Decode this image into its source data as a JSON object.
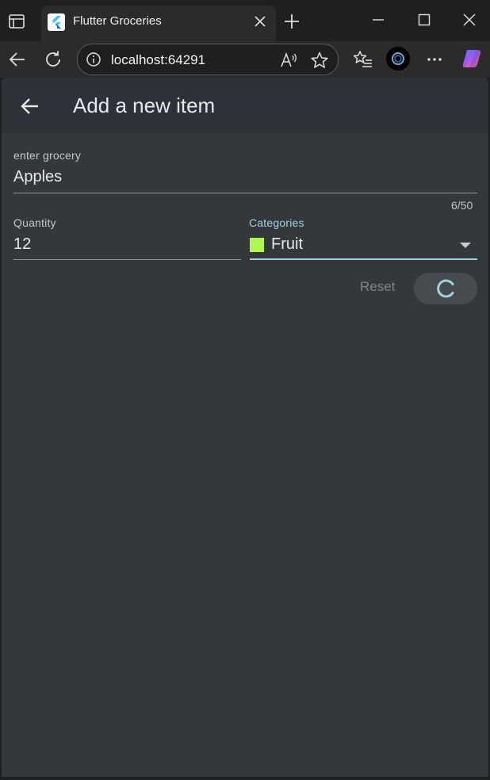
{
  "browser": {
    "tab_title": "Flutter Groceries",
    "url": "localhost:64291"
  },
  "icons": {
    "tab_actions": "tab-actions-icon",
    "favicon": "flutter-logo-icon",
    "tab_close": "close-icon",
    "new_tab": "plus-icon",
    "minimize": "minimize-icon",
    "maximize": "maximize-icon",
    "close_window": "close-icon",
    "back": "arrow-left-icon",
    "reload": "reload-icon",
    "site_info": "info-icon",
    "read_aloud": "read-aloud-icon",
    "favorite": "star-icon",
    "favorites_list": "favorites-list-icon",
    "profile": "profile-avatar",
    "more": "more-horizontal-icon",
    "copilot": "copilot-icon",
    "dropdown": "dropdown-arrow-icon",
    "spinner": "loading-spinner-icon"
  },
  "app": {
    "title": "Add a new item",
    "grocery_field": {
      "label": "enter grocery",
      "value": "Apples",
      "counter": "6/50"
    },
    "quantity_field": {
      "label": "Quantity",
      "value": "12"
    },
    "category_field": {
      "label": "Categories",
      "value": "Fruit",
      "swatch_color": "#aef74c"
    },
    "reset_label": "Reset"
  },
  "colors": {
    "accent": "#9fd2df",
    "app_background": "#34383b",
    "appbar_background": "#2c3237"
  }
}
